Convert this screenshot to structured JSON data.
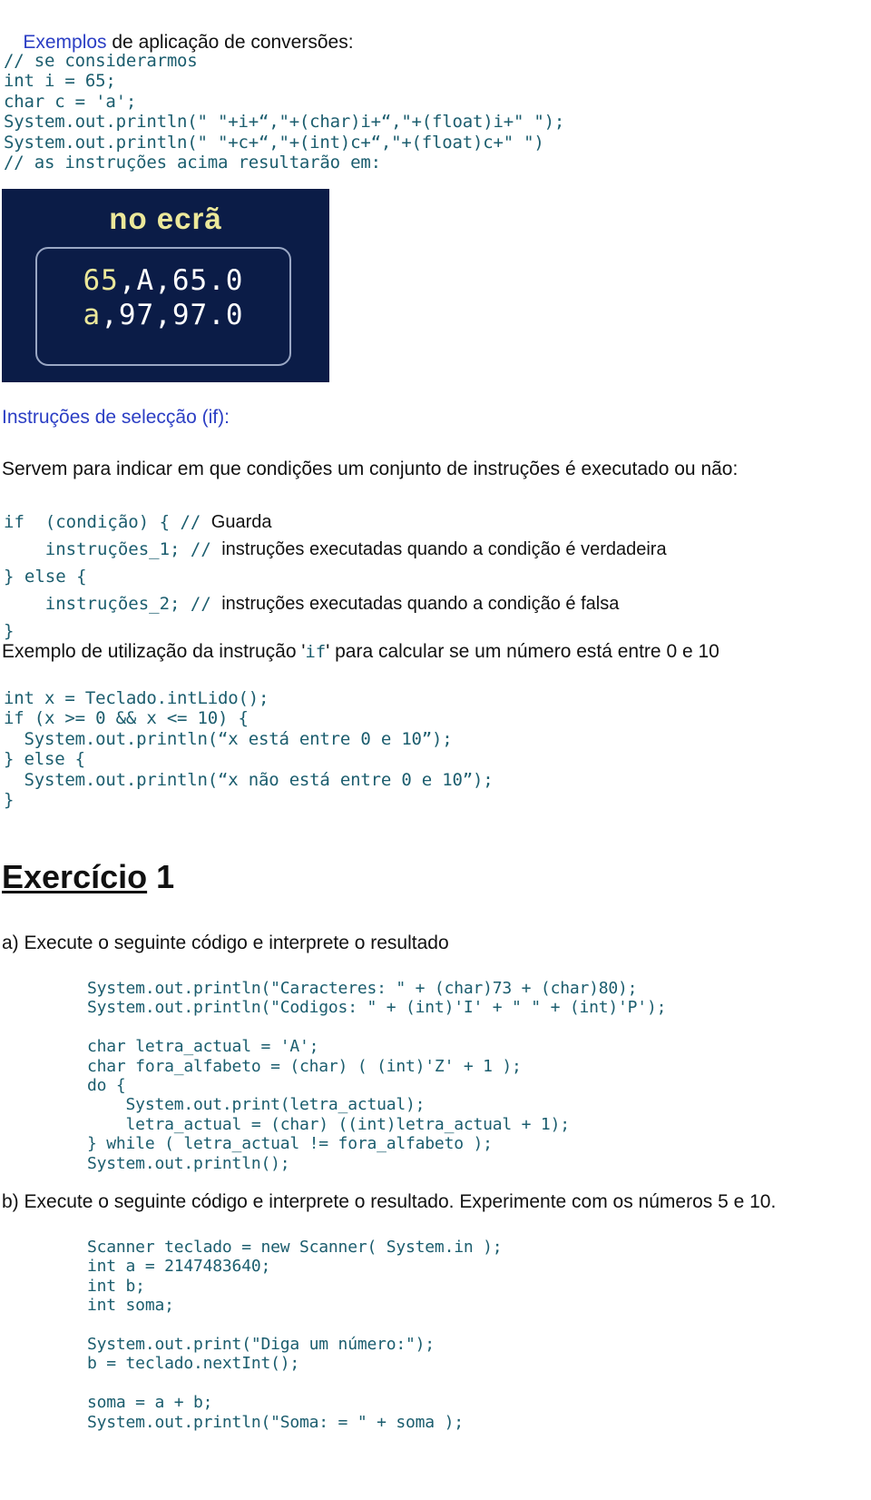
{
  "document": {
    "title_line": {
      "accent": "Exemplos",
      "rest": " de aplicação de conversões:"
    },
    "code_conversions": "// se considerarmos\nint i = 65;\nchar c = 'a';\nSystem.out.println(\" \"+i+“,\"+(char)i+“,\"+(float)i+\" \");\nSystem.out.println(\" \"+c+“,\"+(int)c+“,\"+(float)c+\" \")\n// as instruções acima resultarão em:",
    "screen_figure": {
      "caption": "no ecrã",
      "line1_highlight": "65",
      "line1_rest": ",A,65.0",
      "line2_highlight": "a",
      "line2_rest": ",97,97.0",
      "bg_color": "#0b1c47",
      "highlight_color": "#ece89a",
      "text_color": "#ffffff",
      "border_color": "#9aa7c4"
    },
    "if_section": {
      "heading": "Instruções de selecção (if):",
      "intro": "Servem para indicar em que condições um conjunto de instruções é executado ou não:",
      "lines": [
        {
          "code": "if  (condição) { ",
          "slashes": "// ",
          "comment": "Guarda"
        },
        {
          "code": "    instruções_1; ",
          "slashes": "// ",
          "comment": "instruções executadas quando a condição é verdadeira"
        },
        {
          "code": "} else { ",
          "slashes": "",
          "comment": ""
        },
        {
          "code": "    instruções_2; ",
          "slashes": "// ",
          "comment": "instruções executadas quando a condição é falsa"
        },
        {
          "code": "}",
          "slashes": "",
          "comment": ""
        }
      ]
    },
    "example_if": {
      "text_before": "Exemplo de utilização da instrução '",
      "text_code": "if",
      "text_after": "' para calcular se um número está entre 0 e 10",
      "code": "int x = Teclado.intLido();\nif (x >= 0 && x <= 10) {\n  System.out.println(“x está entre 0 e 10”);\n} else {\n  System.out.println(“x não está entre 0 e 10”);\n}"
    },
    "exercise": {
      "heading_underlined": "Exercício",
      "heading_number": " 1",
      "item_a_label": "a) Execute o seguinte código e interprete o resultado",
      "item_a_code": "System.out.println(\"Caracteres: \" + (char)73 + (char)80);\nSystem.out.println(\"Codigos: \" + (int)'I' + \" \" + (int)'P');\n\nchar letra_actual = 'A';\nchar fora_alfabeto = (char) ( (int)'Z' + 1 );\ndo {\n    System.out.print(letra_actual);\n    letra_actual = (char) ((int)letra_actual + 1);\n} while ( letra_actual != fora_alfabeto );\nSystem.out.println();",
      "item_b_label": "b) Execute o seguinte código e interprete o resultado. Experimente com os números 5 e 10.",
      "item_b_code": "Scanner teclado = new Scanner( System.in );\nint a = 2147483640;\nint b;\nint soma;\n\nSystem.out.print(\"Diga um número:\");\nb = teclado.nextInt();\n\nsoma = a + b;\nSystem.out.println(\"Soma: = \" + soma );"
    },
    "colors": {
      "accent_blue": "#2b3ec4",
      "code_teal": "#1b5d6e",
      "body_text": "#111111"
    }
  }
}
